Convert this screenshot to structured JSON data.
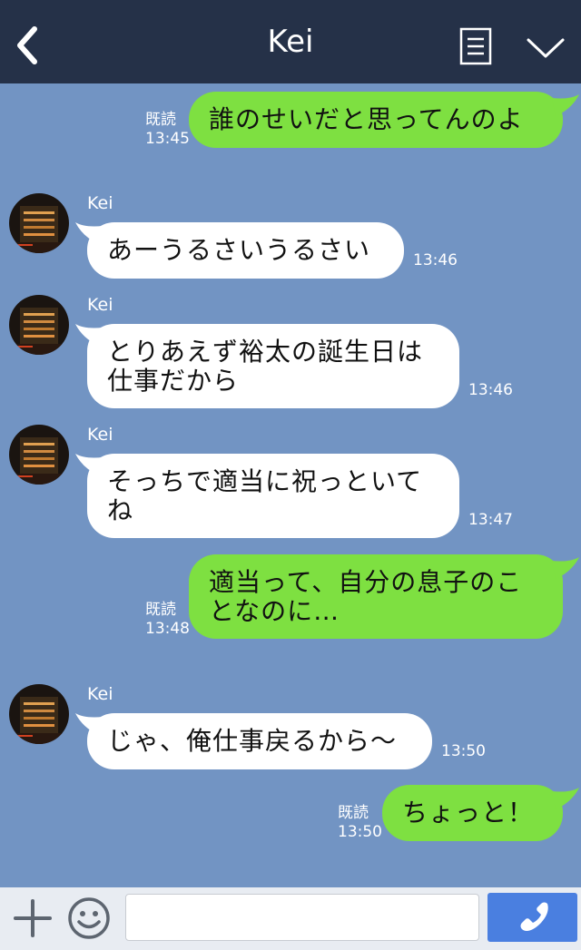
{
  "header": {
    "title": "Kei",
    "back_icon": "chevron-left-icon",
    "menu_icon": "document-menu-icon",
    "more_icon": "chevron-down-icon",
    "background": "#253148"
  },
  "chat": {
    "background": "#7294c3",
    "outgoing_color": "#7ee041",
    "incoming_color": "#ffffff",
    "messages": [
      {
        "direction": "outgoing",
        "text": "誰のせいだと思ってんのよ",
        "status": "既読",
        "time": "13:45"
      },
      {
        "direction": "incoming",
        "sender": "Kei",
        "text": "あーうるさいうるさい",
        "time": "13:46"
      },
      {
        "direction": "incoming",
        "sender": "Kei",
        "text": "とりあえず裕太の誕生日は\n仕事だから",
        "time": "13:46"
      },
      {
        "direction": "incoming",
        "sender": "Kei",
        "text": "そっちで適当に祝っといて\nね",
        "time": "13:47"
      },
      {
        "direction": "outgoing",
        "text": "適当って、自分の息子のこ\nとなのに…",
        "status": "既読",
        "time": "13:48"
      },
      {
        "direction": "incoming",
        "sender": "Kei",
        "text": "じゃ、俺仕事戻るから〜",
        "time": "13:50"
      },
      {
        "direction": "outgoing",
        "text": "ちょっと！",
        "status": "既読",
        "time": "13:50"
      }
    ]
  },
  "input_bar": {
    "plus_icon": "plus-icon",
    "emoji_icon": "smiley-icon",
    "input_value": "",
    "input_placeholder": "",
    "call_icon": "phone-icon",
    "call_color": "#4a7fe0"
  }
}
